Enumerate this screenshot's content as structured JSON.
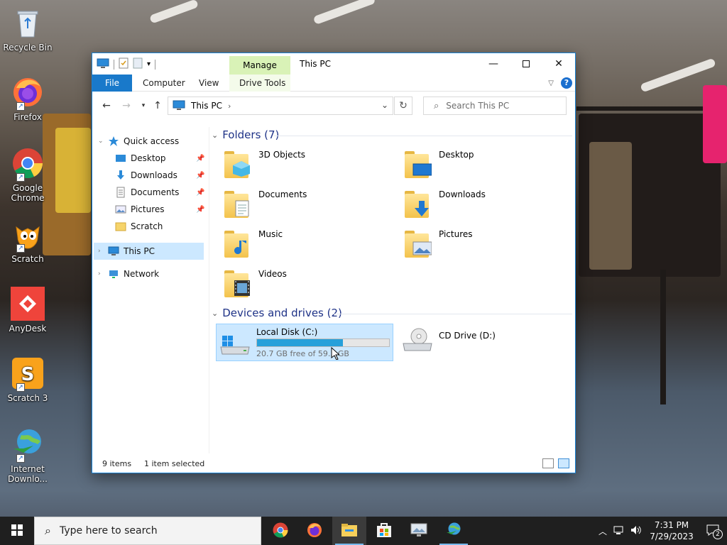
{
  "desktop": {
    "icons": [
      {
        "label": "Recycle Bin"
      },
      {
        "label": "Firefox"
      },
      {
        "label": "Google Chrome"
      },
      {
        "label": "Scratch"
      },
      {
        "label": "AnyDesk"
      },
      {
        "label": "Scratch 3"
      },
      {
        "label": "Internet Downlo..."
      }
    ]
  },
  "window": {
    "title": "This PC",
    "manage_tab": "Manage",
    "ribbon_tabs": {
      "file": "File",
      "computer": "Computer",
      "view": "View",
      "drive_tools": "Drive Tools"
    },
    "help": "?",
    "address": {
      "crumb": "This PC"
    },
    "search": {
      "placeholder": "Search This PC"
    },
    "sidebar": {
      "quick_access": "Quick access",
      "items": [
        {
          "label": "Desktop",
          "pinned": true
        },
        {
          "label": "Downloads",
          "pinned": true
        },
        {
          "label": "Documents",
          "pinned": true
        },
        {
          "label": "Pictures",
          "pinned": true
        },
        {
          "label": "Scratch",
          "pinned": false
        }
      ],
      "this_pc": "This PC",
      "network": "Network"
    },
    "folders_group": "Folders (7)",
    "folders": [
      {
        "name": "3D Objects"
      },
      {
        "name": "Desktop"
      },
      {
        "name": "Documents"
      },
      {
        "name": "Downloads"
      },
      {
        "name": "Music"
      },
      {
        "name": "Pictures"
      },
      {
        "name": "Videos"
      }
    ],
    "devices_group": "Devices and drives (2)",
    "drives": [
      {
        "name": "Local Disk (C:)",
        "free_text": "20.7 GB free of 59.3 GB",
        "used_fraction": 0.65,
        "selected": true
      },
      {
        "name": "CD Drive (D:)"
      }
    ],
    "status": {
      "items": "9 items",
      "selected": "1 item selected"
    }
  },
  "taskbar": {
    "search_placeholder": "Type here to search",
    "time": "7:31 PM",
    "date": "7/29/2023",
    "notifications": "2"
  },
  "colors": {
    "accent": "#1979ca",
    "selection": "#cce8ff",
    "manage": "#d9f2b7",
    "taskbar": "#1f1f1f"
  }
}
